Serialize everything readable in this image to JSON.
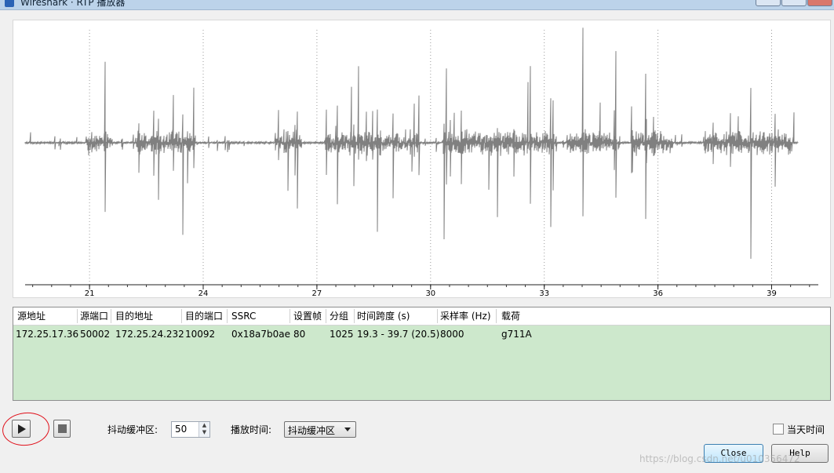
{
  "window": {
    "title": "Wireshark · RTP 播放器"
  },
  "waveform": {
    "axis_ticks": [
      "21",
      "24",
      "27",
      "30",
      "33",
      "36",
      "39"
    ],
    "axis_range_seconds": [
      19.3,
      39.7
    ],
    "color": "#808080"
  },
  "table": {
    "headers": [
      "源地址",
      "源端口",
      "目的地址",
      "目的端口",
      "SSRC",
      "设置帧",
      "分组",
      "时间跨度 (s)",
      "采样率 (Hz)",
      "载荷"
    ],
    "rows": [
      [
        "172.25.17.36",
        "50002",
        "172.25.24.232",
        "10092",
        "0x18a7b0ae",
        "80",
        "1025",
        "19.3 - 39.7 (20.5)",
        "8000",
        "g711A"
      ]
    ],
    "row_color": "#cde8cc"
  },
  "controls": {
    "jitter_label": "抖动缓冲区:",
    "jitter_value": "50",
    "playtime_label": "播放时间:",
    "playtime_value": "抖动缓冲区",
    "realtime_label": "当天时间",
    "close_label": "Close",
    "help_label": "Help"
  },
  "watermark": "https://blog.csdn.net/u010356472"
}
